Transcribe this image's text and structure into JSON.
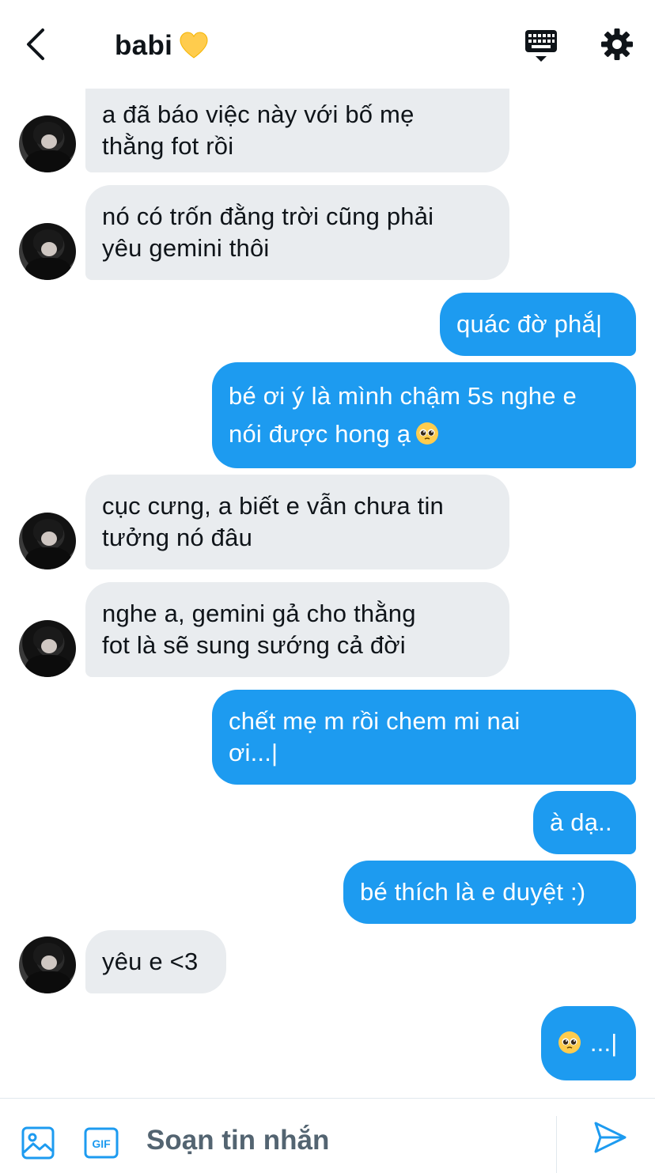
{
  "header": {
    "title": "babi",
    "title_emoji": "yellow-heart",
    "icons": {
      "back": "chevron-left-icon",
      "keyboard": "keyboard-icon",
      "settings": "gear-icon"
    }
  },
  "colors": {
    "accent": "#1d9bf0",
    "incoming_bubble": "#e9ecef",
    "text": "#0f1419",
    "muted": "#536471"
  },
  "messages": [
    {
      "from": "them",
      "text": "a đã báo việc này với bố mẹ\nthằng fot rồi"
    },
    {
      "from": "them",
      "text": "nó có trốn đằng trời cũng phải\nyêu gemini thôi"
    },
    {
      "from": "me",
      "text": "quác đờ phắ|"
    },
    {
      "from": "me",
      "text": "bé ơi ý là mình chậm 5s nghe e\nnói được hong ạ",
      "emoji": "pleading-face"
    },
    {
      "from": "them",
      "text": "cục cưng, a biết e vẫn chưa tin\ntưởng nó đâu"
    },
    {
      "from": "them",
      "text": "nghe a, gemini gả cho thằng\nfot là sẽ sung sướng cả đời"
    },
    {
      "from": "me",
      "text": "chết mẹ m rồi chem mi nai\nơi...|"
    },
    {
      "from": "me",
      "text": "à dạ.."
    },
    {
      "from": "me",
      "text": "bé thích là e duyệt :)"
    },
    {
      "from": "them",
      "text": "yêu e <3"
    },
    {
      "from": "me",
      "text": " ...|",
      "emoji_before": "pleading-face"
    }
  ],
  "composer": {
    "placeholder": "Soạn tin nhắn",
    "icons": {
      "image": "image-icon",
      "gif": "gif-icon",
      "send": "send-icon"
    },
    "gif_label": "GIF"
  }
}
